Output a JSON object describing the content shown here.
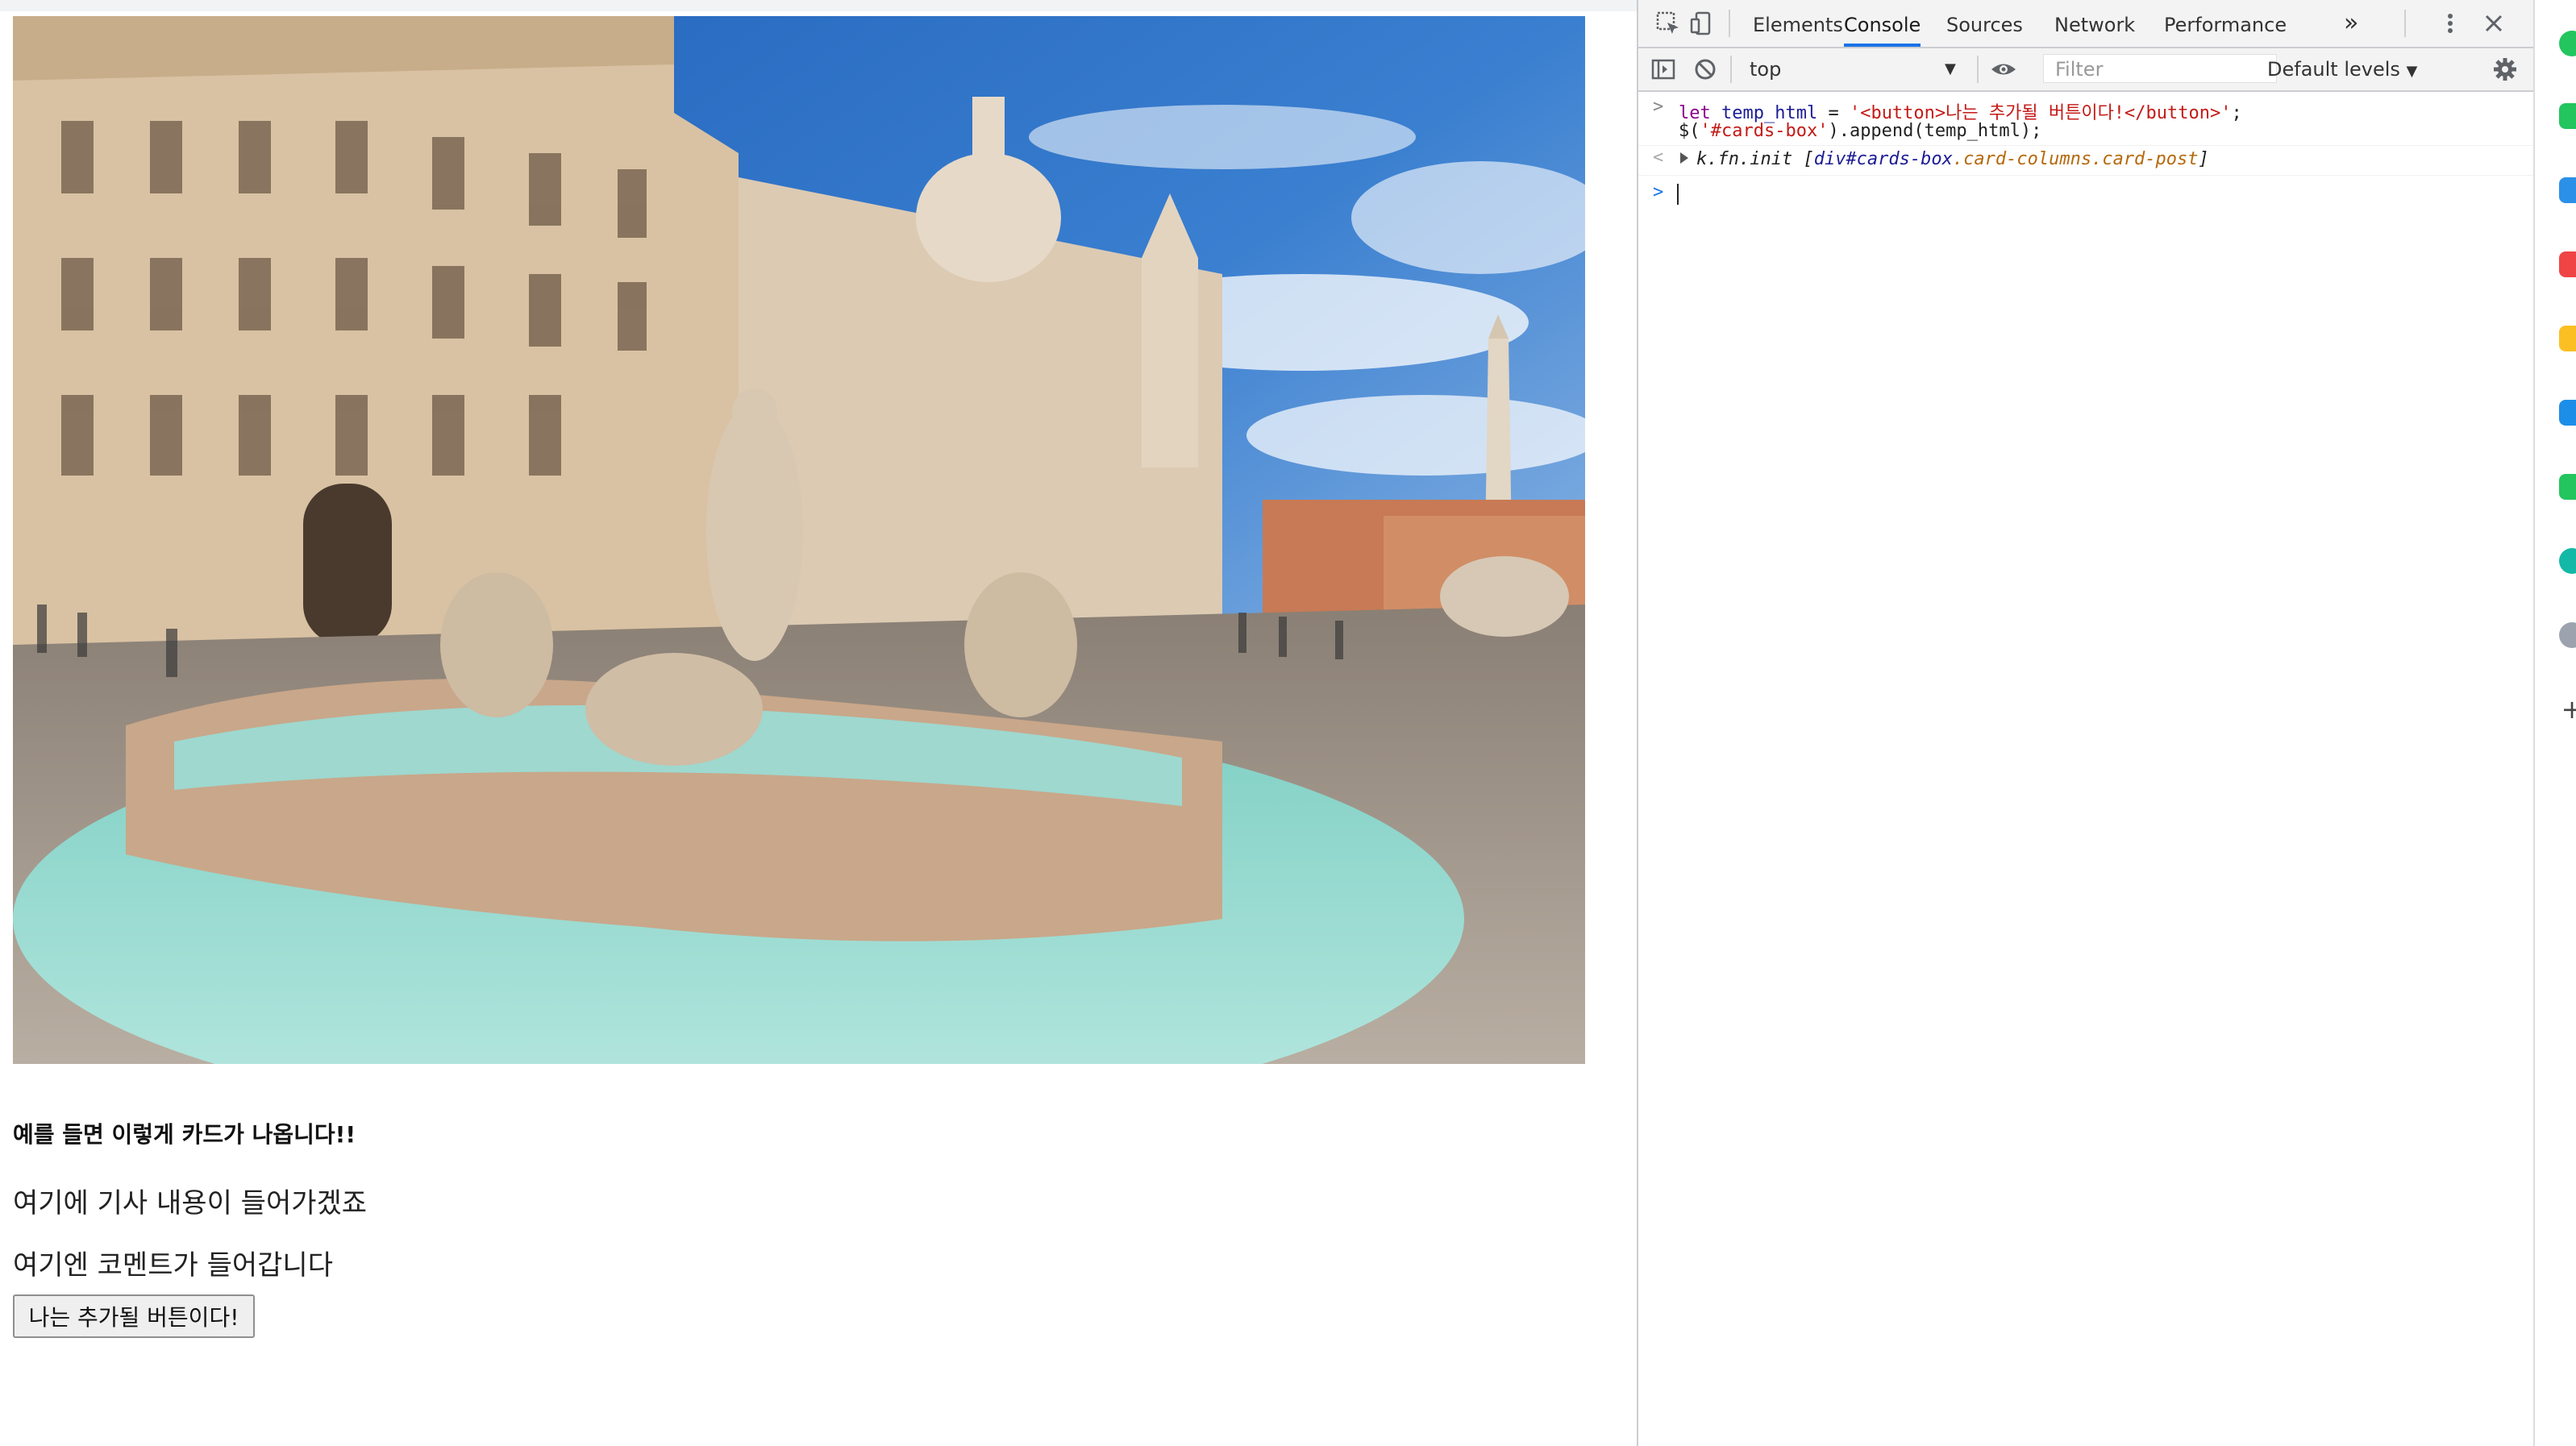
{
  "page": {
    "photo_alt": "",
    "card_title": "예를 들면 이렇게 카드가 나옵니다!!",
    "card_text": "여기에 기사 내용이 들어가겠죠",
    "card_comment": "여기엔 코멘트가 들어갑니다",
    "added_button": "나는 추가될 버튼이다!"
  },
  "devtools": {
    "tabs": [
      "Elements",
      "Console",
      "Sources",
      "Network",
      "Performance"
    ],
    "active_tab": "Console",
    "more_tabs_glyph": "»",
    "context": "top",
    "filter_placeholder": "Filter",
    "levels": "Default levels",
    "console": {
      "input_line1_kw": "let",
      "input_line1_var": " temp_html",
      "input_line1_eq": " = ",
      "input_line1_str": "'<button>나는 추가될 버튼이다!</button>'",
      "input_line1_end": ";",
      "input_line2_pre": "$(",
      "input_line2_str": "'#cards-box'",
      "input_line2_post": ").append(temp_html);",
      "result_prefix": "k.fn.init [",
      "result_sel": "div#cards-box",
      "result_cls": ".card-columns.card-post",
      "result_suffix": "]"
    }
  },
  "colors": {
    "accent": "#1a73e8",
    "string": "#c41a16",
    "keyword": "#8b008b"
  },
  "extension_icons": [
    "green-chat-icon",
    "green-chat-icon",
    "blue-doc-icon",
    "red-pocket-icon",
    "yellow-star-icon",
    "blue-ext-icon",
    "green-ext-icon",
    "teal-play-icon",
    "avatar-ext-icon",
    "plus-icon"
  ]
}
